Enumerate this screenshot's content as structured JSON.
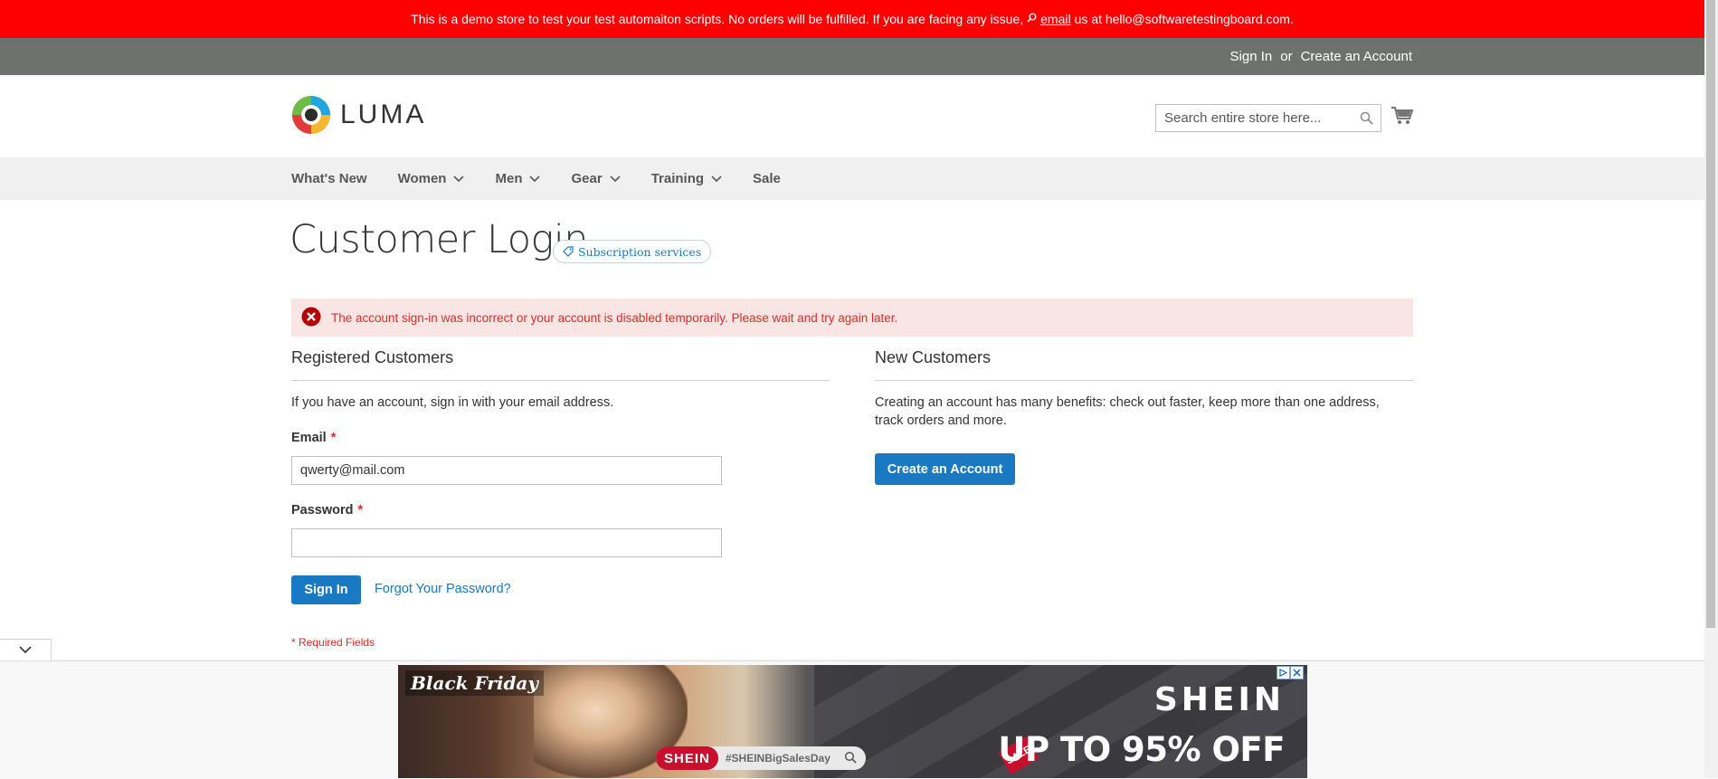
{
  "demo_notice": {
    "text_before": "This is a demo store to test your test automaiton scripts. No orders will be fulfilled. If you are facing any issue,",
    "link_text": "email",
    "text_after": "us at hello@softwaretestingboard.com."
  },
  "header_links": {
    "sign_in": "Sign In",
    "or": "or",
    "create_account": "Create an Account"
  },
  "logo": {
    "text": "LUMA"
  },
  "search": {
    "placeholder": "Search entire store here...",
    "value": ""
  },
  "nav": {
    "items": [
      {
        "label": "What's New",
        "has_dropdown": false
      },
      {
        "label": "Women",
        "has_dropdown": true
      },
      {
        "label": "Men",
        "has_dropdown": true
      },
      {
        "label": "Gear",
        "has_dropdown": true
      },
      {
        "label": "Training",
        "has_dropdown": true
      },
      {
        "label": "Sale",
        "has_dropdown": false
      }
    ]
  },
  "page": {
    "title": "Customer Login",
    "badge": "Subscription services"
  },
  "error": {
    "message": "The account sign-in was incorrect or your account is disabled temporarily. Please wait and try again later."
  },
  "registered": {
    "title": "Registered Customers",
    "intro": "If you have an account, sign in with your email address.",
    "email_label": "Email",
    "email_value": "qwerty@mail.com",
    "password_label": "Password",
    "password_value": "",
    "required_mark": "*",
    "sign_in_button": "Sign In",
    "forgot_link": "Forgot Your Password?",
    "required_note": "* Required Fields"
  },
  "new_customers": {
    "title": "New Customers",
    "text": "Creating an account has many benefits: check out faster, keep more than one address, track orders and more.",
    "button": "Create an Account"
  },
  "ad": {
    "headline_left": "Black Friday",
    "brand": "SHEIN",
    "pill_brand": "SHEIN",
    "hashtag": "#SHEINBigSalesDay",
    "sale_tag": "SALE",
    "offer": "UP TO 95% OFF"
  },
  "colors": {
    "demo_bar": "#ff0000",
    "header_links_bar": "#6e716e",
    "primary": "#1979c3",
    "error_text": "#e02b27",
    "error_bg": "#fae5e5"
  }
}
